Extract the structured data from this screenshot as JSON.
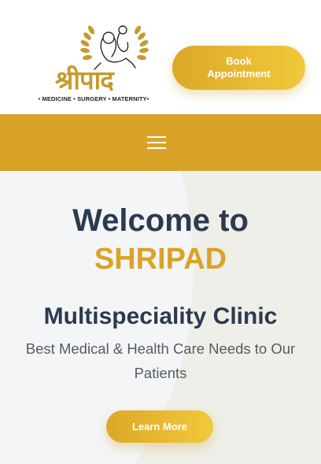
{
  "header": {
    "logo": {
      "wordmark": "श्रीपाद",
      "tagline": "• MEDICINE • SURGERY • MATERNITY•",
      "icon": "mother-and-child-laurel-emblem"
    },
    "book_button_label": "Book Appointment"
  },
  "navbar": {
    "menu_icon": "hamburger-menu-icon"
  },
  "hero": {
    "title": "Welcome to",
    "brand": "SHRIPAD",
    "subtitle": "Multispeciality Clinic",
    "description": "Best Medical & Health Care Needs to Our Patients",
    "cta_label": "Learn More"
  },
  "colors": {
    "accent": "#d9a328",
    "accent_light": "#f2c93a",
    "heading": "#2b3a4f",
    "body_text": "#555b63",
    "hero_bg": "#f4f5f7"
  }
}
